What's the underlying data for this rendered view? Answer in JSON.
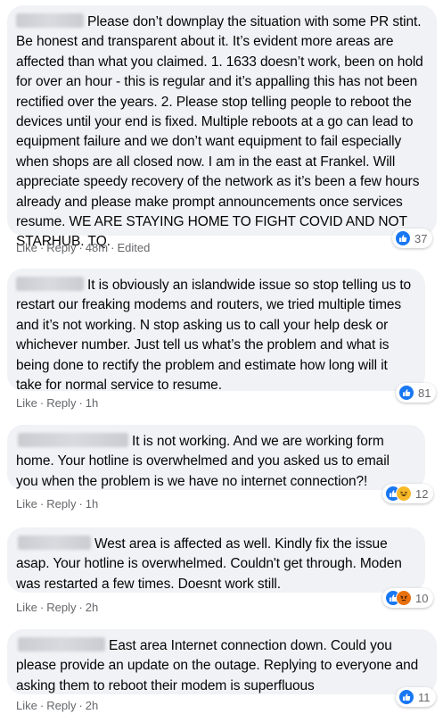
{
  "comments": [
    {
      "text": "Please don’t downplay the situation with some PR stint. Be honest and transparent about it. It’s evident more areas are affected than what you claimed. 1. 1633 doesn’t work, been on hold for over an hour - this is regular and it’s appalling this has not been rectified over the years. 2. Please stop telling people to reboot the devices until your end is fixed. Multiple reboots at a go can lead to equipment failure and we don’t want equipment to fail especially when shops are all closed now. I am in the east at Frankel. Will appreciate speedy recovery of the network as it’s been a few hours already and please make prompt announcements once services resume. WE ARE STAYING HOME TO FIGHT COVID AND NOT STARHUB. TQ.",
      "like_label": "Like",
      "reply_label": "Reply",
      "time": "48m",
      "edited": "Edited",
      "reaction_icons": [
        "like-icon"
      ],
      "reaction_count": "37"
    },
    {
      "text": "It is obviously an islandwide issue so stop telling us to restart our freaking modems and routers, we tried multiple times and it’s not working. N stop asking us to call your help desk or whichever number. Just tell us what’s the problem and what is being done to rectify the problem and estimate how long will it take for normal service to resume.",
      "like_label": "Like",
      "reply_label": "Reply",
      "time": "1h",
      "reaction_icons": [
        "like-icon"
      ],
      "reaction_count": "81"
    },
    {
      "text": "It is not working. And we are working form home. Your hotline is overwhelmed and you asked us to email you when the problem is we have no internet connection?!",
      "like_label": "Like",
      "reply_label": "Reply",
      "time": "1h",
      "reaction_icons": [
        "like-icon",
        "haha-icon"
      ],
      "reaction_count": "12"
    },
    {
      "text": "West area is affected as well. Kindly fix the issue asap. Your hotline is overwhelmed. Couldn't get through. Moden was restarted a few times. Doesnt work still.",
      "like_label": "Like",
      "reply_label": "Reply",
      "time": "2h",
      "reaction_icons": [
        "like-icon",
        "angry-icon"
      ],
      "reaction_count": "10"
    },
    {
      "text": "East area Internet connection down. Could you please provide an update on the outage. Replying to everyone and asking them to reboot their modem is superfluous",
      "like_label": "Like",
      "reply_label": "Reply",
      "time": "2h",
      "reaction_icons": [
        "like-icon"
      ],
      "reaction_count": "11"
    }
  ],
  "colors": {
    "bubble": "#f0f2f5",
    "meta_text": "#65676b",
    "like_blue": "#1877f2",
    "haha_yellow": "#f7b928",
    "angry_orange": "#e9710f"
  }
}
